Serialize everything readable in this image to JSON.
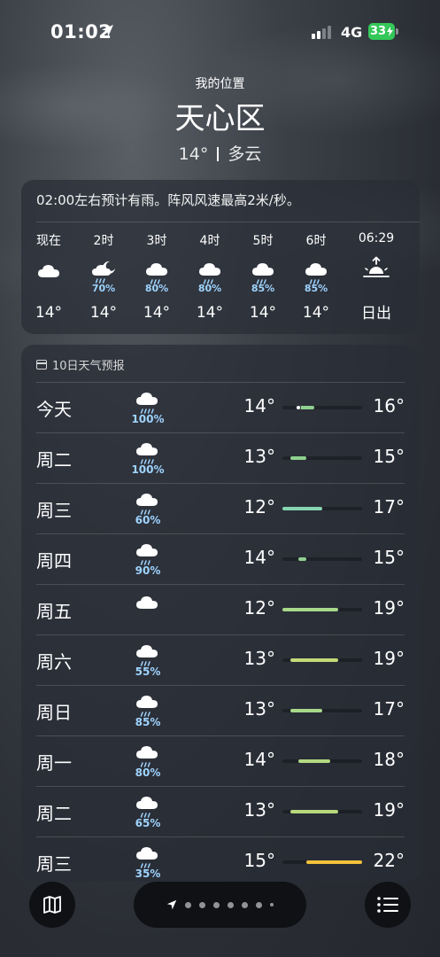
{
  "status_bar": {
    "time": "01:02",
    "network": "4G",
    "battery": "33"
  },
  "header": {
    "location_label": "我的位置",
    "city": "天心区",
    "temperature": "14°",
    "condition": "多云"
  },
  "hourly": {
    "summary": "02:00左右预计有雨。阵风风速最高2米/秒。",
    "items": [
      {
        "label": "现在",
        "icon": "cloud-icon",
        "precip": "",
        "temp": "14°"
      },
      {
        "label": "2时",
        "icon": "moon-rain-icon",
        "precip": "70%",
        "temp": "14°"
      },
      {
        "label": "3时",
        "icon": "rain-icon",
        "precip": "80%",
        "temp": "14°"
      },
      {
        "label": "4时",
        "icon": "rain-icon",
        "precip": "80%",
        "temp": "14°"
      },
      {
        "label": "5时",
        "icon": "rain-icon",
        "precip": "85%",
        "temp": "14°"
      },
      {
        "label": "6时",
        "icon": "rain-icon",
        "precip": "85%",
        "temp": "14°"
      },
      {
        "label": "06:29",
        "icon": "sunrise-icon",
        "precip": "",
        "temp": "日出"
      }
    ]
  },
  "daily": {
    "title": "10日天气预报",
    "range": [
      12,
      22
    ],
    "days": [
      {
        "day": "今天",
        "icon": "heavy-rain-icon",
        "precip": "100%",
        "low": "14°",
        "high": "16°",
        "low_v": 14,
        "high_v": 16,
        "current_v": 14,
        "color": "#8fd18f"
      },
      {
        "day": "周二",
        "icon": "heavy-rain-icon",
        "precip": "100%",
        "low": "13°",
        "high": "15°",
        "low_v": 13,
        "high_v": 15,
        "color": "#8fd18f"
      },
      {
        "day": "周三",
        "icon": "rain-icon",
        "precip": "60%",
        "low": "12°",
        "high": "17°",
        "low_v": 12,
        "high_v": 17,
        "color": "#86d4b0"
      },
      {
        "day": "周四",
        "icon": "rain-icon",
        "precip": "90%",
        "low": "14°",
        "high": "15°",
        "low_v": 14,
        "high_v": 15,
        "color": "#8fd18f"
      },
      {
        "day": "周五",
        "icon": "cloud-icon",
        "precip": "",
        "low": "12°",
        "high": "19°",
        "low_v": 12,
        "high_v": 19,
        "color": "#a8d88a"
      },
      {
        "day": "周六",
        "icon": "rain-icon",
        "precip": "55%",
        "low": "13°",
        "high": "19°",
        "low_v": 13,
        "high_v": 19,
        "color": "#c4da78"
      },
      {
        "day": "周日",
        "icon": "rain-icon",
        "precip": "85%",
        "low": "13°",
        "high": "17°",
        "low_v": 13,
        "high_v": 17,
        "color": "#a8d88a"
      },
      {
        "day": "周一",
        "icon": "rain-icon",
        "precip": "80%",
        "low": "14°",
        "high": "18°",
        "low_v": 14,
        "high_v": 18,
        "color": "#b2d882"
      },
      {
        "day": "周二",
        "icon": "rain-icon",
        "precip": "65%",
        "low": "13°",
        "high": "19°",
        "low_v": 13,
        "high_v": 19,
        "color": "#b8d87c"
      },
      {
        "day": "周三",
        "icon": "rain-icon",
        "precip": "35%",
        "low": "15°",
        "high": "22°",
        "low_v": 15,
        "high_v": 22,
        "color": "#f2c23a"
      }
    ]
  },
  "bottom_bar": {
    "map_icon": "map-icon",
    "list_icon": "list-icon",
    "page_count": 8,
    "current_page": 0
  }
}
